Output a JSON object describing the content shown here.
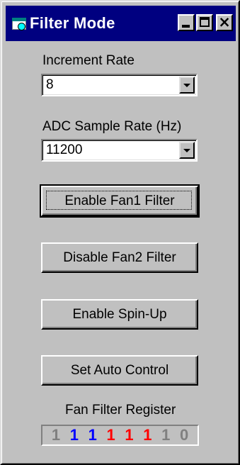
{
  "window": {
    "title": "Filter Mode"
  },
  "increment_rate": {
    "label": "Increment Rate",
    "value": "8"
  },
  "adc_sample_rate": {
    "label": "ADC Sample Rate (Hz)",
    "value": "11200"
  },
  "buttons": {
    "fan1_filter": "Enable Fan1 Filter",
    "fan2_filter": "Disable Fan2 Filter",
    "spin_up": "Enable Spin-Up",
    "auto_control": "Set Auto Control"
  },
  "register": {
    "label": "Fan Filter Register",
    "bits": [
      {
        "value": "1",
        "color": "#808080"
      },
      {
        "value": "1",
        "color": "#0000ff"
      },
      {
        "value": "1",
        "color": "#0000ff"
      },
      {
        "value": "1",
        "color": "#ff0000"
      },
      {
        "value": "1",
        "color": "#ff0000"
      },
      {
        "value": "1",
        "color": "#ff0000"
      },
      {
        "value": "1",
        "color": "#808080"
      },
      {
        "value": "0",
        "color": "#808080"
      }
    ]
  }
}
